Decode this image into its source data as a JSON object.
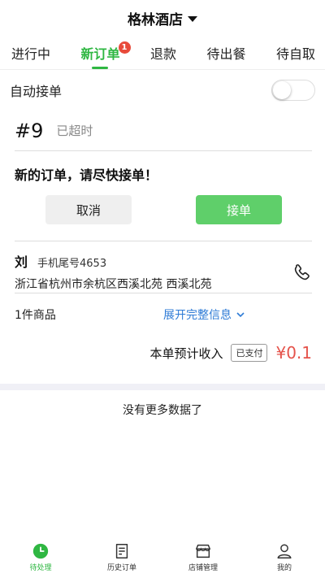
{
  "header": {
    "store_name": "格林酒店"
  },
  "tabs": [
    {
      "label": "进行中"
    },
    {
      "label": "新订单",
      "badge": "1",
      "active": true
    },
    {
      "label": "退款"
    },
    {
      "label": "待出餐"
    },
    {
      "label": "待自取"
    }
  ],
  "auto_accept": {
    "label": "自动接单",
    "enabled": false
  },
  "order": {
    "number": "#9",
    "status": "已超时",
    "message": "新的订单，请尽快接单！",
    "cancel_label": "取消",
    "accept_label": "接单",
    "customer_name": "刘",
    "phone_tail": "手机尾号4653",
    "address": "浙江省杭州市余杭区西溪北苑 西溪北苑",
    "goods_count": "1件商品",
    "expand_label": "展开完整信息",
    "income_label": "本单预计收入",
    "paid_badge": "已支付",
    "amount": "¥0.1"
  },
  "list_end": "没有更多数据了",
  "bottom_nav": [
    {
      "label": "待处理",
      "icon": "clock-icon",
      "active": true
    },
    {
      "label": "历史订单",
      "icon": "document-icon"
    },
    {
      "label": "店铺管理",
      "icon": "store-icon"
    },
    {
      "label": "我的",
      "icon": "user-icon"
    }
  ],
  "colors": {
    "accent": "#2fb742",
    "accept_button": "#5fcf6a",
    "price": "#e5534b",
    "link": "#2e7bd6",
    "badge": "#e84a3a"
  }
}
